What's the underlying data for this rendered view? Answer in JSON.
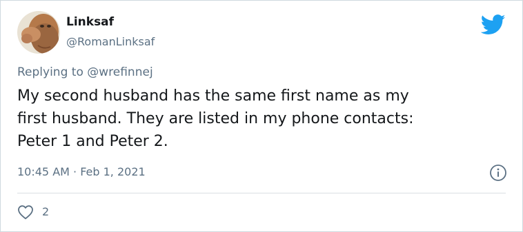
{
  "tweet": {
    "display_name": "Linksaf",
    "handle": "@RomanLinksaf",
    "reply_prefix": "Replying to",
    "reply_mention": "@wrefinnej",
    "text_lines": [
      "My second husband has the same first name as my",
      "first husband. They are listed in my phone contacts:",
      "Peter 1 and Peter 2."
    ],
    "timestamp": "10:45 AM · Feb 1, 2021",
    "like_count": "2"
  },
  "icons": {
    "logo": "twitter-bird-icon",
    "info": "info-icon",
    "like": "heart-icon"
  },
  "colors": {
    "twitter_blue": "#1da1f2",
    "text_primary": "#14171a",
    "text_secondary": "#5b7083",
    "divider": "#d9dfe3"
  }
}
